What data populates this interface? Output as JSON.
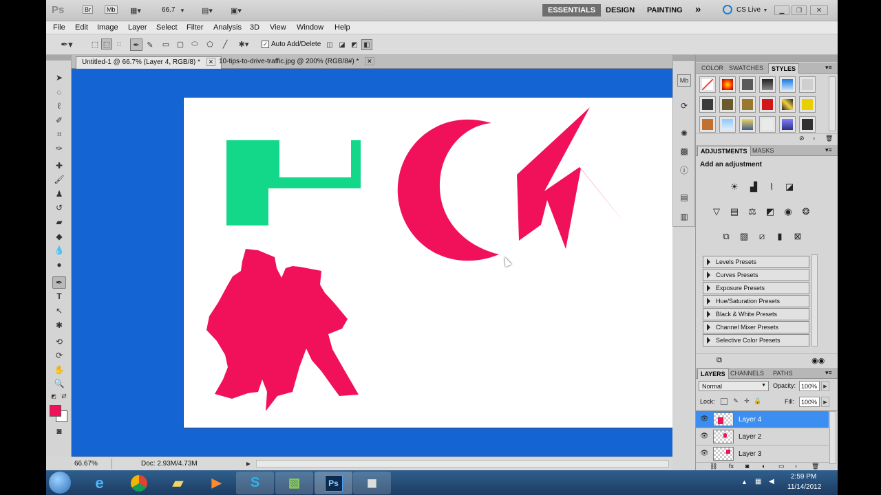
{
  "appbar": {
    "logo": "Ps",
    "bridge": "Br",
    "minibridge": "Mb",
    "zoom": "66.7",
    "workspaces": [
      "ESSENTIALS",
      "DESIGN",
      "PAINTING"
    ],
    "more": "»",
    "cslive": "CS Live"
  },
  "menu": [
    "File",
    "Edit",
    "Image",
    "Layer",
    "Select",
    "Filter",
    "Analysis",
    "3D",
    "View",
    "Window",
    "Help"
  ],
  "options": {
    "auto_add_delete": "Auto Add/Delete"
  },
  "tabs": [
    {
      "label": "Untitled-1 @ 66.7% (Layer 4, RGB/8) *",
      "active": true
    },
    {
      "label": "10-tips-to-drive-traffic.jpg @ 200% (RGB/8#) *",
      "active": false
    }
  ],
  "status": {
    "zoom": "66.67%",
    "doc": "Doc: 2.93M/4.73M"
  },
  "colors": {
    "workarea": "#1464d4",
    "shape_green": "#13d88a",
    "shape_red": "#f0115a",
    "foreground": "#f0115a"
  },
  "panels": {
    "color_group": {
      "tabs": [
        "COLOR",
        "SWATCHES",
        "STYLES"
      ],
      "active": "STYLES"
    },
    "adjust_group": {
      "tabs": [
        "ADJUSTMENTS",
        "MASKS"
      ],
      "active": "ADJUSTMENTS",
      "heading": "Add an adjustment"
    },
    "presets": [
      "Levels Presets",
      "Curves Presets",
      "Exposure Presets",
      "Hue/Saturation Presets",
      "Black & White Presets",
      "Channel Mixer Presets",
      "Selective Color Presets"
    ],
    "layers_group": {
      "tabs": [
        "LAYERS",
        "CHANNELS",
        "PATHS"
      ],
      "active": "LAYERS",
      "blend_mode": "Normal",
      "opacity_label": "Opacity:",
      "opacity": "100%",
      "lock_label": "Lock:",
      "fill_label": "Fill:",
      "fill": "100%",
      "layers": [
        {
          "name": "Layer 4",
          "selected": true
        },
        {
          "name": "Layer 2",
          "selected": false
        },
        {
          "name": "Layer 3",
          "selected": false
        }
      ]
    }
  },
  "clock": {
    "time": "2:59 PM",
    "date": "11/14/2012"
  }
}
